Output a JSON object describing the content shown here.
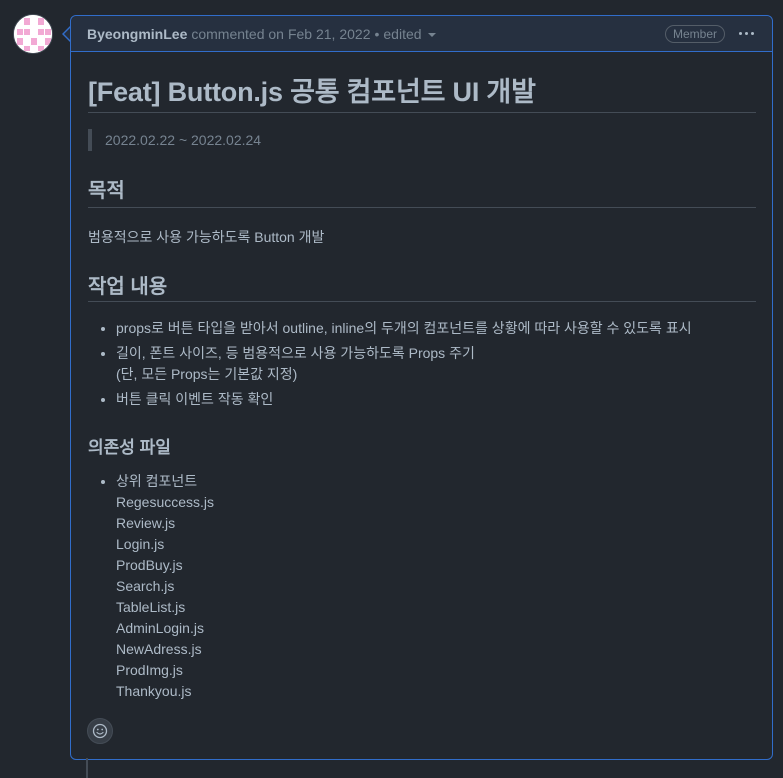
{
  "comment": {
    "author": "ByeongminLee",
    "action": "commented on",
    "date": "Feb 21, 2022",
    "separator": "•",
    "edited": "edited",
    "badge": "Member"
  },
  "body": {
    "title": "[Feat] Button.js 공통 컴포넌트 UI 개발",
    "date_range": "2022.02.22 ~ 2022.02.24",
    "purpose_heading": "목적",
    "purpose_text": "범용적으로 사용 가능하도록 Button 개발",
    "work_heading": "작업 내용",
    "work_items": [
      {
        "line1": "props로 버튼 타입을 받아서 outline, inline의 두개의 컴포넌트를 상황에 따라 사용할 수 있도록 표시",
        "line2": ""
      },
      {
        "line1": "길이, 폰트 사이즈, 등 범용적으로 사용 가능하도록 Props 주기",
        "line2": "(단, 모든 Props는 기본값 지정)"
      },
      {
        "line1": "버튼 클릭 이벤트 작동 확인",
        "line2": ""
      }
    ],
    "deps_heading": "의존성 파일",
    "deps_parent": "상위 컴포넌트",
    "deps_files": [
      "Regesuccess.js",
      "Review.js",
      "Login.js",
      "ProdBuy.js",
      "Search.js",
      "TableList.js",
      "AdminLogin.js",
      "NewAdress.js",
      "ProdImg.js",
      "Thankyou.js"
    ]
  },
  "icons": {
    "avatar": "identicon-avatar",
    "menu": "kebab-horizontal-icon",
    "reaction": "smiley-icon"
  },
  "colors": {
    "background": "#22272e",
    "border_accent": "#316dca",
    "header_bg": "#263040",
    "text": "#adbac7",
    "muted": "#768390",
    "avatar_pattern": "#f2a9d4"
  }
}
